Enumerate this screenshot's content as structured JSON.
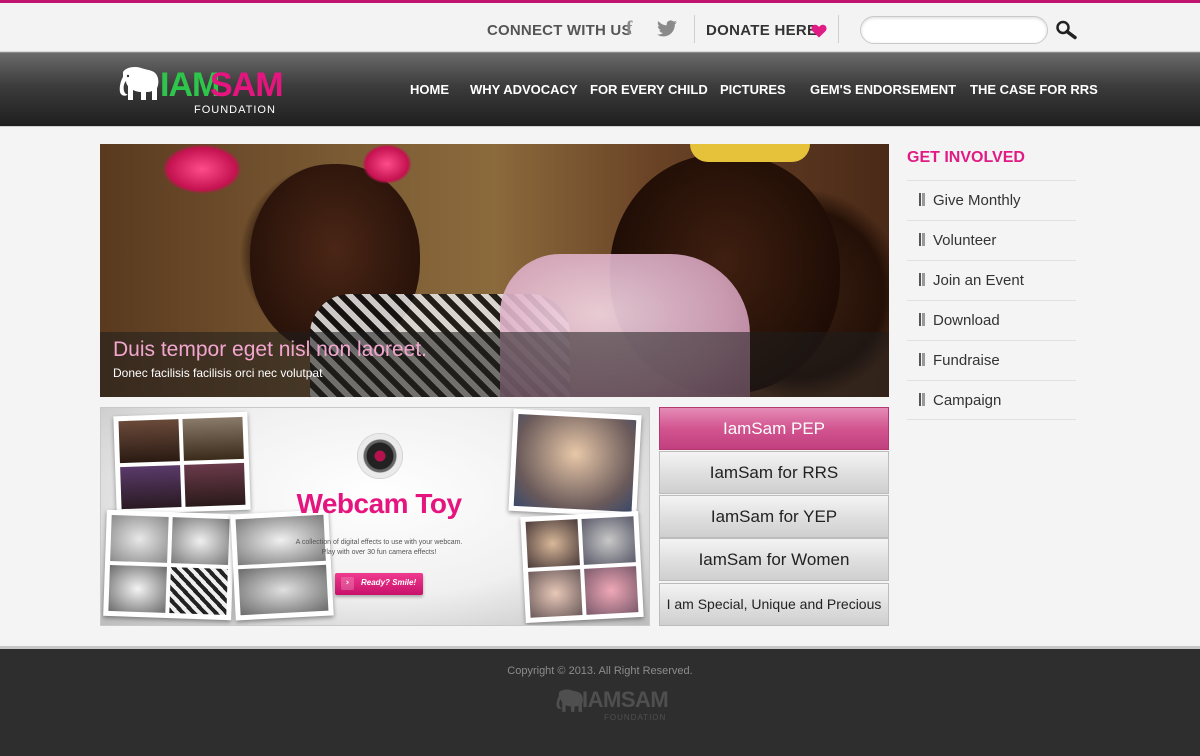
{
  "topbar": {
    "connect_label": "CONNECT WITH US",
    "facebook_glyph": "f",
    "donate_label": "DONATE HERE",
    "search_placeholder": "",
    "icons": [
      "facebook-icon",
      "twitter-icon",
      "heart-icon",
      "search-icon"
    ]
  },
  "logo": {
    "iam": "IAM",
    "sam": "SAM",
    "foundation": "FOUNDATION"
  },
  "nav": {
    "items": [
      {
        "label": "HOME"
      },
      {
        "label": "WHY ADVOCACY"
      },
      {
        "label": "FOR EVERY CHILD"
      },
      {
        "label": "PICTURES"
      },
      {
        "label": "GEM'S ENDORSEMENT"
      },
      {
        "label": "THE CASE FOR RRS"
      }
    ]
  },
  "hero": {
    "title": "Duis tempor eget nisl non laoreet.",
    "subtitle": "Donec facilisis facilisis orci nec volutpat"
  },
  "promo": {
    "title": "Webcam Toy",
    "description_line1": "A collection of digital effects to use with your webcam.",
    "description_line2": "Play with over 30 fun camera effects!",
    "button_label": "Ready? Smile!"
  },
  "programs": {
    "items": [
      {
        "label": "IamSam PEP",
        "active": true
      },
      {
        "label": "IamSam for RRS",
        "active": false
      },
      {
        "label": "IamSam for YEP",
        "active": false
      },
      {
        "label": "IamSam for Women",
        "active": false
      },
      {
        "label": "I am Special, Unique and Precious",
        "active": false
      }
    ]
  },
  "sidebar": {
    "heading": "GET INVOLVED",
    "items": [
      {
        "label": "Give Monthly"
      },
      {
        "label": "Volunteer"
      },
      {
        "label": "Join an Event"
      },
      {
        "label": "Download"
      },
      {
        "label": "Fundraise"
      },
      {
        "label": "Campaign"
      }
    ]
  },
  "footer": {
    "copyright": "Copyright © 2013. All Right Reserved.",
    "logo_text": "IAMSAM",
    "logo_sub": "FOUNDATION"
  },
  "colors": {
    "accent_pink": "#e6147f",
    "accent_green": "#2ec64a",
    "top_border": "#c0156f",
    "footer_bg": "#2e2e2e"
  }
}
